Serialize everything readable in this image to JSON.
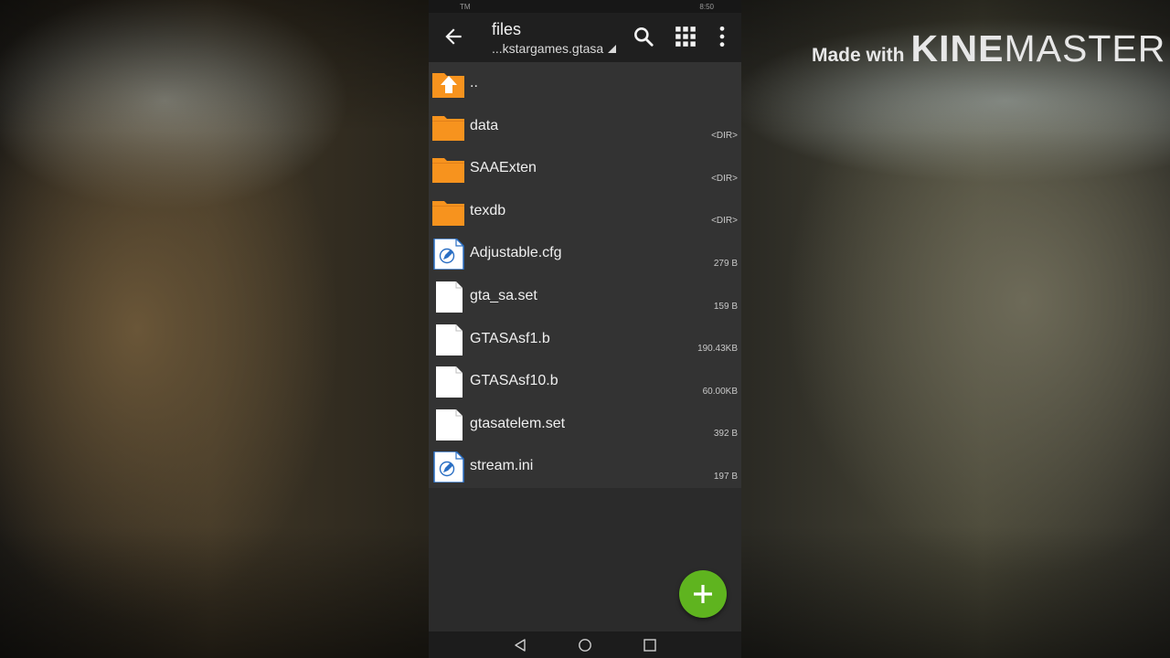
{
  "background": {
    "watermark": {
      "prefix": "Made with",
      "brand_a": "KINE",
      "brand_b": "MASTER"
    }
  },
  "status_bar": {
    "carrier": "TM",
    "time": "8:50"
  },
  "toolbar": {
    "title": "files",
    "path": "...kstargames.gtasa",
    "icons": [
      "back-arrow-icon",
      "search-icon",
      "grid-view-icon",
      "more-vert-icon"
    ]
  },
  "files": [
    {
      "name": "..",
      "size": "",
      "type": "parent"
    },
    {
      "name": "data",
      "size": "<DIR>",
      "type": "folder"
    },
    {
      "name": "SAAExten",
      "size": "<DIR>",
      "type": "folder"
    },
    {
      "name": "texdb",
      "size": "<DIR>",
      "type": "folder"
    },
    {
      "name": "Adjustable.cfg",
      "size": "279 B",
      "type": "text"
    },
    {
      "name": "gta_sa.set",
      "size": "159 B",
      "type": "file"
    },
    {
      "name": "GTASAsf1.b",
      "size": "190.43KB",
      "type": "file"
    },
    {
      "name": "GTASAsf10.b",
      "size": "60.00KB",
      "type": "file"
    },
    {
      "name": "gtasatelem.set",
      "size": "392 B",
      "type": "file"
    },
    {
      "name": "stream.ini",
      "size": "197 B",
      "type": "text"
    }
  ],
  "fab": {
    "icon": "plus-icon"
  },
  "nav_bar": {
    "icons": [
      "back-triangle-icon",
      "home-circle-icon",
      "recents-square-icon"
    ]
  },
  "colors": {
    "folder": "#f7931e",
    "fab": "#5fb41f",
    "text_icon": "#2a6fc4",
    "background": "#333333",
    "toolbar": "#1f1f1f"
  }
}
